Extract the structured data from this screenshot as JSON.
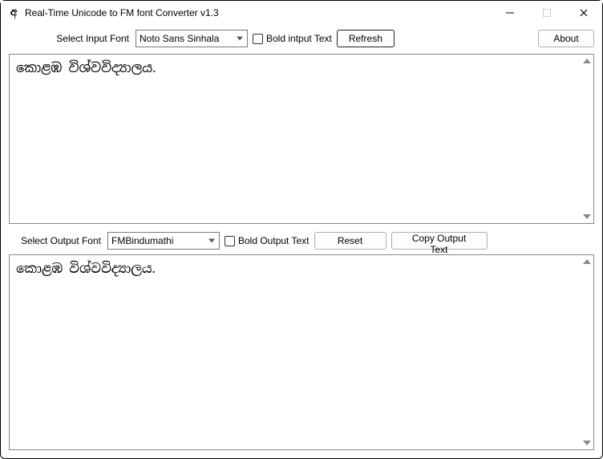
{
  "window": {
    "title": "Real-Time Unicode to FM font Converter v1.3"
  },
  "toolbar_top": {
    "input_font_label": "Select Input Font",
    "input_font_value": "Noto Sans Sinhala",
    "bold_input_label": "Bold intput Text",
    "refresh_label": "Refresh",
    "about_label": "About"
  },
  "input_area": {
    "text": "කොළඹ විශ්වවිද්‍යාලය."
  },
  "toolbar_bottom": {
    "output_font_label": "Select Output Font",
    "output_font_value": "FMBindumathi",
    "bold_output_label": "Bold Output Text",
    "reset_label": "Reset",
    "copy_label": "Copy Output Text"
  },
  "output_area": {
    "text": "කොළඹ විශ්වවිද්‍යාලය."
  }
}
